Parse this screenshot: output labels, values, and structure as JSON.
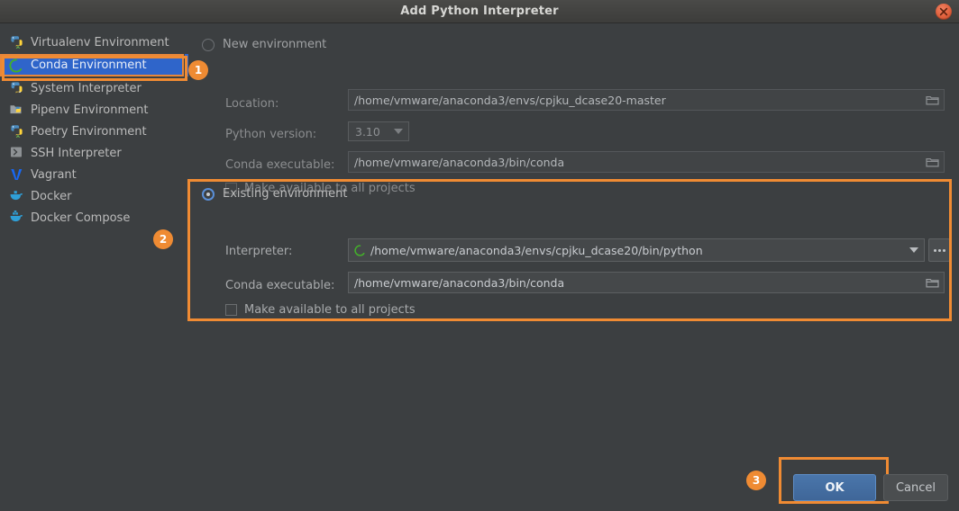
{
  "window": {
    "title": "Add Python Interpreter",
    "close_icon": "close-icon"
  },
  "sidebar": {
    "items": [
      {
        "label": "Virtualenv Environment",
        "icon": "python-venv-icon",
        "selected": false
      },
      {
        "label": "Conda Environment",
        "icon": "conda-icon",
        "selected": true
      },
      {
        "label": "System Interpreter",
        "icon": "python-icon",
        "selected": false
      },
      {
        "label": "Pipenv Environment",
        "icon": "pipenv-icon",
        "selected": false
      },
      {
        "label": "Poetry Environment",
        "icon": "python-venv-icon",
        "selected": false
      },
      {
        "label": "SSH Interpreter",
        "icon": "terminal-icon",
        "selected": false
      },
      {
        "label": "Vagrant",
        "icon": "vagrant-icon",
        "selected": false
      },
      {
        "label": "Docker",
        "icon": "docker-icon",
        "selected": false
      },
      {
        "label": "Docker Compose",
        "icon": "docker-compose-icon",
        "selected": false
      }
    ]
  },
  "new_environment": {
    "radio_label": "New environment",
    "selected": false,
    "location": {
      "label": "Location:",
      "value": "/home/vmware/anaconda3/envs/cpjku_dcase20-master",
      "browse_icon": "folder-icon"
    },
    "python_version": {
      "label": "Python version:",
      "value": "3.10",
      "options": [
        "3.10"
      ]
    },
    "conda_executable": {
      "label": "Conda executable:",
      "value": "/home/vmware/anaconda3/bin/conda",
      "browse_icon": "folder-icon"
    },
    "make_available": {
      "label": "Make available to all projects",
      "checked": false
    }
  },
  "existing_environment": {
    "radio_label": "Existing environment",
    "selected": true,
    "interpreter": {
      "label": "Interpreter:",
      "value": "/home/vmware/anaconda3/envs/cpjku_dcase20/bin/python",
      "icon": "conda-icon",
      "dropdown_icon": "chevron-down-icon",
      "more_button_label": "...",
      "options": [
        "/home/vmware/anaconda3/envs/cpjku_dcase20/bin/python"
      ]
    },
    "conda_executable": {
      "label": "Conda executable:",
      "value": "/home/vmware/anaconda3/bin/conda",
      "browse_icon": "folder-icon"
    },
    "make_available": {
      "label": "Make available to all projects",
      "checked": false
    }
  },
  "footer": {
    "ok_label": "OK",
    "cancel_label": "Cancel"
  },
  "annotations": {
    "badge_1": "1",
    "badge_2": "2",
    "badge_3": "3",
    "highlight_color": "#f08b33"
  },
  "colors": {
    "dialog_bg": "#3c3f41",
    "selection_blue": "#2f65ca",
    "accent_orange": "#f08b33",
    "primary_button": "#4a76ab",
    "conda_green": "#43b02a"
  }
}
